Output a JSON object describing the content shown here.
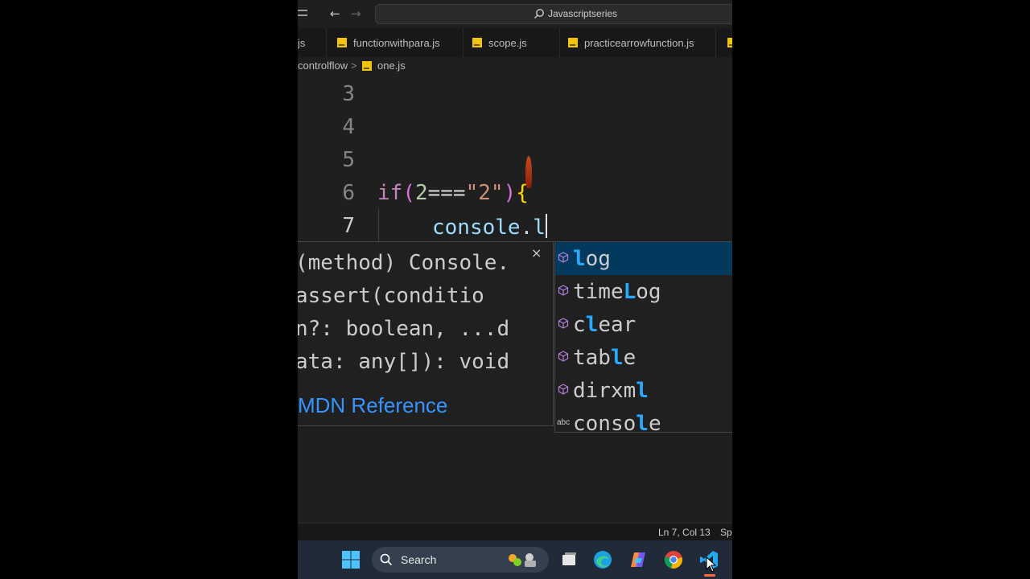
{
  "titlebar": {
    "back_icon": "arrow-left-icon",
    "forward_icon": "arrow-right-icon",
    "search_label": "Javascriptseries"
  },
  "tabs": [
    {
      "label": "js"
    },
    {
      "label": "functionwithpara.js"
    },
    {
      "label": "scope.js"
    },
    {
      "label": "practicearrowfunction.js"
    }
  ],
  "breadcrumb": {
    "folder": "controlflow",
    "separator": ">",
    "file": "one.js"
  },
  "editor": {
    "lines": [
      {
        "number": "3"
      },
      {
        "number": "4"
      },
      {
        "number": "5"
      },
      {
        "number": "6",
        "tokens": {
          "kw": "if",
          "open": "(",
          "num": "2",
          "op": "===",
          "str": "\"2\"",
          "close": ")",
          "brace": "{"
        }
      },
      {
        "number": "7",
        "tokens": {
          "obj": "console",
          "dot": ".",
          "typed": "l"
        }
      }
    ]
  },
  "hover_doc": {
    "signature_lines": [
      "(method) Console.",
      "assert(conditio",
      "n?: boolean, ...d",
      "ata: any[]): void"
    ],
    "close_label": "×",
    "link": "MDN Reference"
  },
  "suggestions": [
    {
      "before": "",
      "match": "l",
      "after": "og",
      "kind": "method",
      "selected": true
    },
    {
      "before": "time",
      "match": "L",
      "after": "og",
      "kind": "method",
      "selected": false
    },
    {
      "before": "c",
      "match": "l",
      "after": "ear",
      "kind": "method",
      "selected": false
    },
    {
      "before": "tab",
      "match": "l",
      "after": "e",
      "kind": "method",
      "selected": false
    },
    {
      "before": "dirxm",
      "match": "l",
      "after": "",
      "kind": "method",
      "selected": false
    },
    {
      "before": "conso",
      "match": "l",
      "after": "e",
      "kind": "text",
      "kind_label": "abc",
      "selected": false
    }
  ],
  "statusbar": {
    "position": "Ln 7, Col 13",
    "trailing": "Sp"
  },
  "taskbar": {
    "search_label": "Search",
    "icons": [
      "windows-start-icon",
      "widgets-icon",
      "task-view-icon",
      "edge-icon",
      "copilot-icon",
      "chrome-icon",
      "vscode-icon"
    ]
  },
  "colors": {
    "accent_selection": "#04395e",
    "match_highlight": "#2aaaff",
    "link": "#3794ff"
  }
}
